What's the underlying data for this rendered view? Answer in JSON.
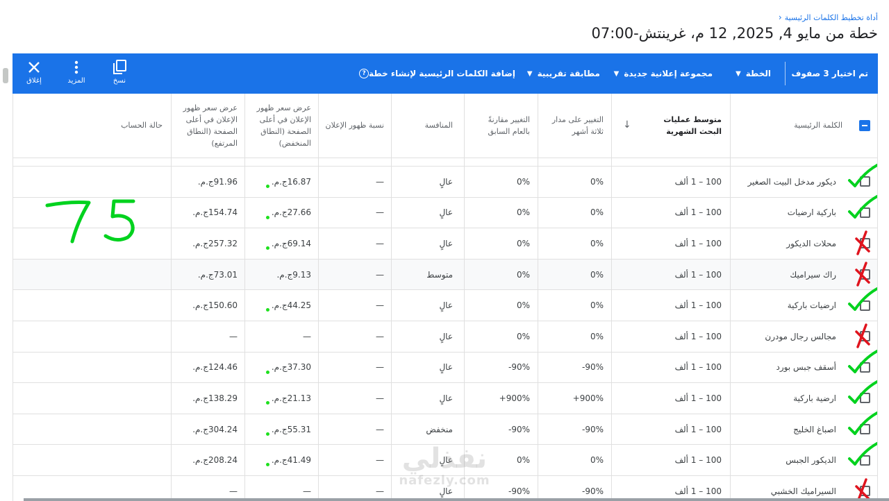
{
  "breadcrumb": "أداة تخطيط الكلمات الرئيسية",
  "page_title": "خطة من مايو 4, 2025, 12 م، غرينتش-07:00",
  "toolbar": {
    "selected": "تم اختيار 3 صفوف",
    "plan": "الخطة",
    "new_ad_group": "مجموعة إعلانية جديدة",
    "match_type": "مطابقة تقريبية",
    "add_keywords": "إضافة الكلمات الرئيسية لإنشاء خطة",
    "copy": "نسخ",
    "more": "المزيد",
    "close": "إغلاق"
  },
  "columns": {
    "keyword": "الكلمة الرئيسية",
    "avg_monthly_searches": "متوسط عمليات البحث الشهرية",
    "three_month_change": "التغيير على مدار ثلاثة أشهر",
    "yoy_change": "التغيير مقارنةً بالعام السابق",
    "competition": "المنافسة",
    "impression_share": "نسبة ظهور الإعلان",
    "top_bid_low": "عرض سعر ظهور الإعلان في أعلى الصفحة (النطاق المنخفض)",
    "top_bid_high": "عرض سعر ظهور الإعلان في أعلى الصفحة (النطاق المرتفع)",
    "account_status": "حالة الحساب"
  },
  "rows": [
    {
      "keyword": "ديكور مدخل البيت الصغير",
      "avg": "100 – 1 ألف",
      "three_month": "0%",
      "yoy": "0%",
      "competition": "عالٍ",
      "impression": "—",
      "low": "16.87ج.م.",
      "high": "91.96ج.م.",
      "mark": "check"
    },
    {
      "keyword": "باركية ارضيات",
      "avg": "100 – 1 ألف",
      "three_month": "0%",
      "yoy": "0%",
      "competition": "عالٍ",
      "impression": "—",
      "low": "27.66ج.م.",
      "high": "154.74ج.م.",
      "mark": "check"
    },
    {
      "keyword": "محلات الديكور",
      "avg": "100 – 1 ألف",
      "three_month": "0%",
      "yoy": "0%",
      "competition": "عالٍ",
      "impression": "—",
      "low": "69.14ج.م.",
      "high": "257.32ج.م.",
      "mark": "cross"
    },
    {
      "keyword": "راك سيراميك",
      "avg": "100 – 1 ألف",
      "three_month": "0%",
      "yoy": "0%",
      "competition": "متوسط",
      "impression": "—",
      "low": "9.13ج.م.",
      "high": "73.01ج.م.",
      "mark": "cross"
    },
    {
      "keyword": "ارضيات باركية",
      "avg": "100 – 1 ألف",
      "three_month": "0%",
      "yoy": "0%",
      "competition": "عالٍ",
      "impression": "—",
      "low": "44.25ج.م.",
      "high": "150.60ج.م.",
      "mark": "check"
    },
    {
      "keyword": "مجالس رجال مودرن",
      "avg": "100 – 1 ألف",
      "three_month": "0%",
      "yoy": "0%",
      "competition": "عالٍ",
      "impression": "—",
      "low": "—",
      "high": "—",
      "mark": "cross"
    },
    {
      "keyword": "أسقف جبس بورد",
      "avg": "100 – 1 ألف",
      "three_month": "90%-",
      "yoy": "90%-",
      "competition": "عالٍ",
      "impression": "—",
      "low": "37.30ج.م.",
      "high": "124.46ج.م.",
      "mark": "check"
    },
    {
      "keyword": "ارضية باركية",
      "avg": "100 – 1 ألف",
      "three_month": "900%+",
      "yoy": "900%+",
      "competition": "عالٍ",
      "impression": "—",
      "low": "21.13ج.م.",
      "high": "138.29ج.م.",
      "mark": "check"
    },
    {
      "keyword": "اصباغ الخليج",
      "avg": "100 – 1 ألف",
      "three_month": "90%-",
      "yoy": "90%-",
      "competition": "منخفض",
      "impression": "—",
      "low": "55.31ج.م.",
      "high": "304.24ج.م.",
      "mark": "check"
    },
    {
      "keyword": "الديكور الجبس",
      "avg": "100 – 1 ألف",
      "three_month": "0%",
      "yoy": "0%",
      "competition": "عالٍ",
      "impression": "—",
      "low": "41.49ج.م.",
      "high": "208.24ج.م.",
      "mark": "check"
    },
    {
      "keyword": "السيراميك الخشبي",
      "avg": "100 – 1 ألف",
      "three_month": "90%-",
      "yoy": "90%-",
      "competition": "عالٍ",
      "impression": "—",
      "low": "—",
      "high": "—",
      "mark": "cross"
    }
  ],
  "annotation": "75",
  "watermark": {
    "arabic": "نفذلي",
    "latin": "nafezly.com"
  },
  "colors": {
    "toolbar": "#1a73e8",
    "ink": "#00d21e",
    "cross": "#e0141e"
  }
}
